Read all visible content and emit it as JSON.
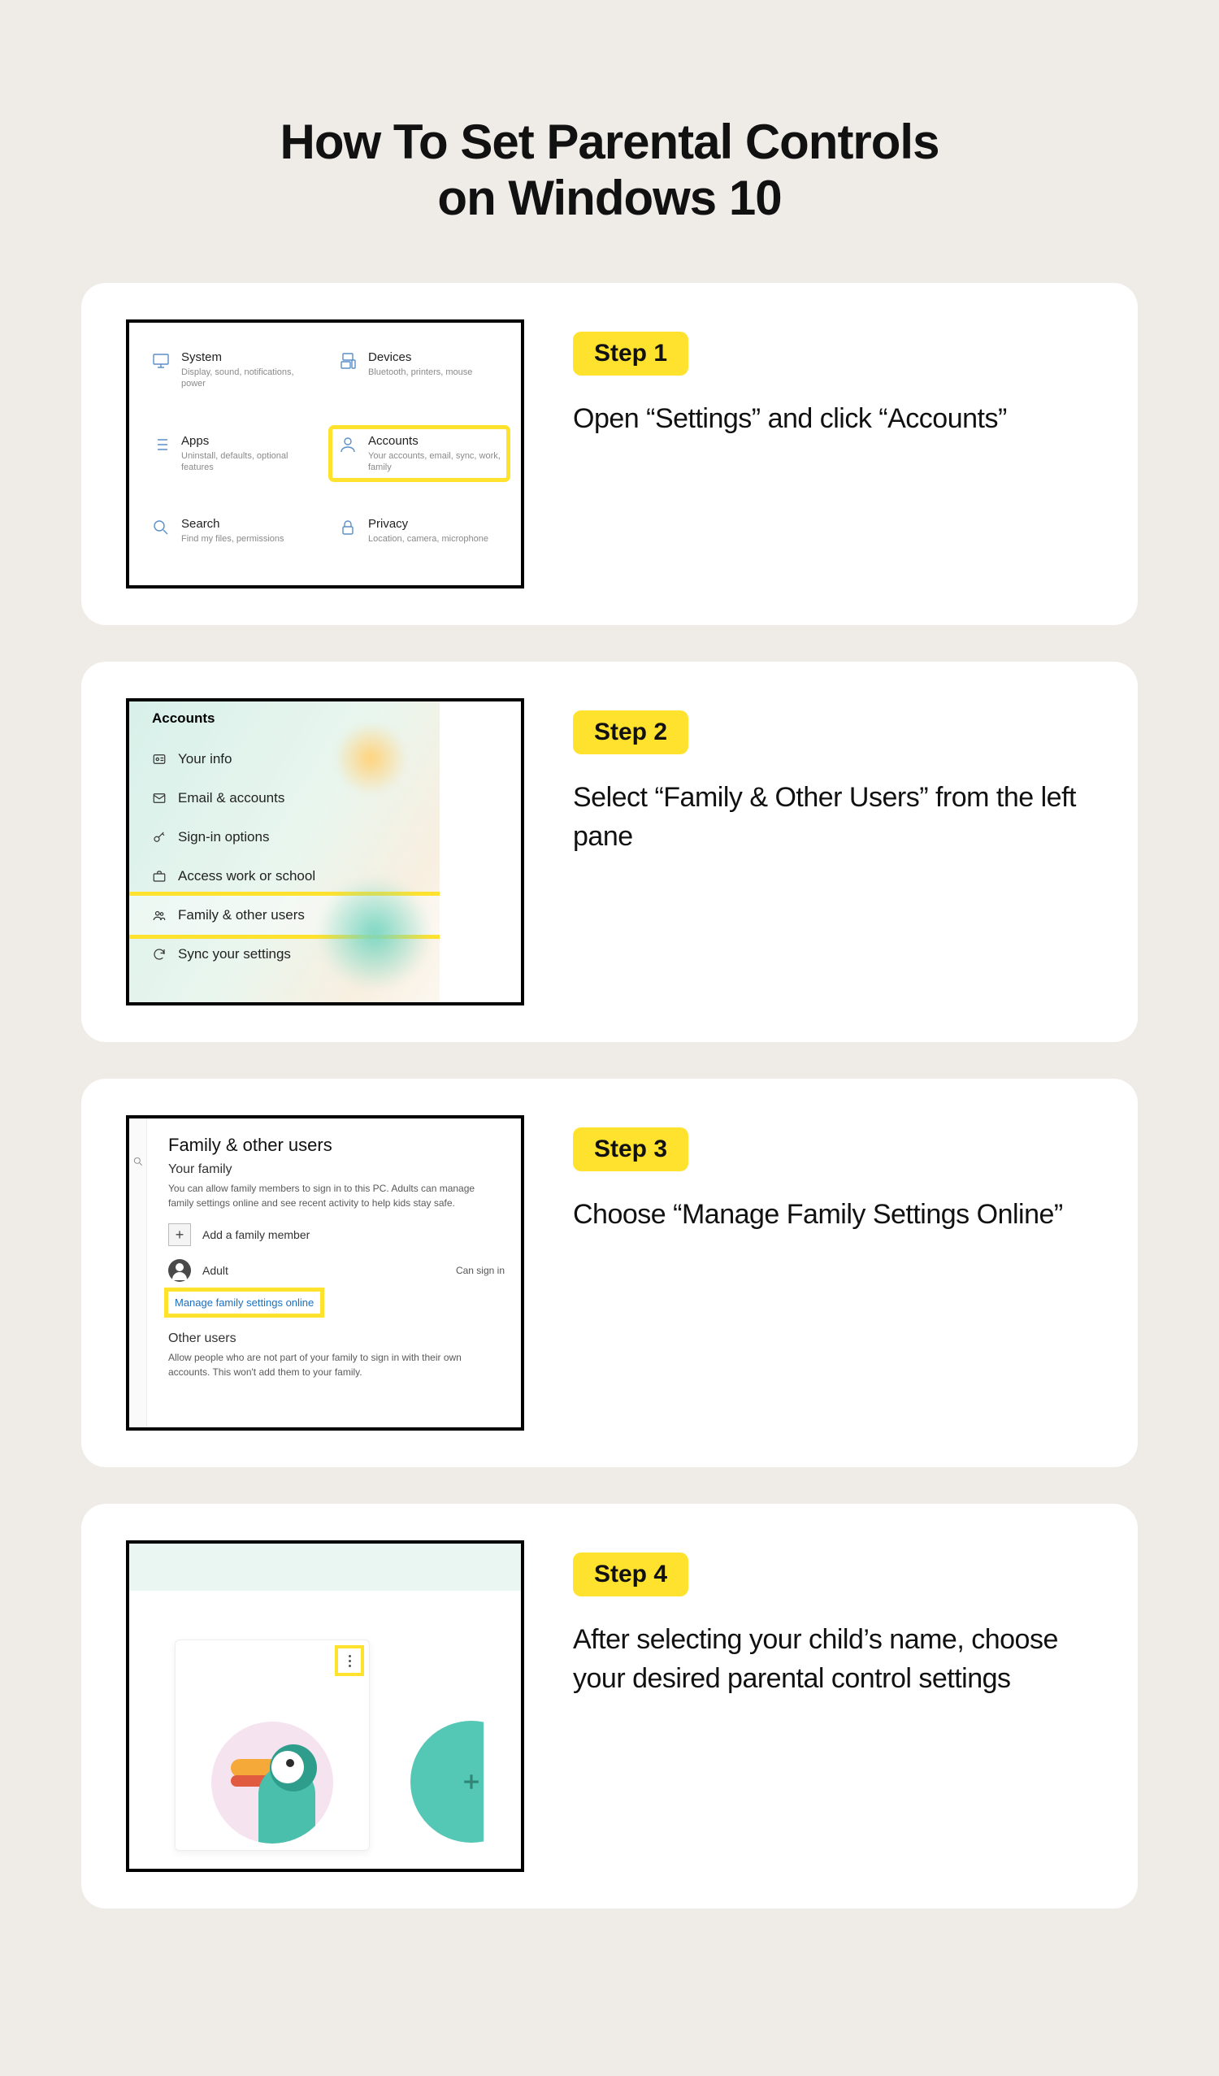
{
  "title_line1": "How To Set Parental Controls",
  "title_line2": "on Windows 10",
  "steps": [
    {
      "badge": "Step 1",
      "text": "Open “Settings” and click “Accounts”"
    },
    {
      "badge": "Step 2",
      "text": "Select “Family & Other Users” from the left pane"
    },
    {
      "badge": "Step 3",
      "text": "Choose “Manage Family Settings Online”"
    },
    {
      "badge": "Step 4",
      "text": "After selecting your child’s name, choose your desired parental control settings"
    }
  ],
  "shot1": {
    "tiles": [
      {
        "name": "System",
        "sub": "Display, sound, notifications, power",
        "icon": "monitor"
      },
      {
        "name": "Devices",
        "sub": "Bluetooth, printers, mouse",
        "icon": "devices"
      },
      {
        "name": "Apps",
        "sub": "Uninstall, defaults, optional features",
        "icon": "list"
      },
      {
        "name": "Accounts",
        "sub": "Your accounts, email, sync, work, family",
        "icon": "person",
        "highlight": true
      },
      {
        "name": "Search",
        "sub": "Find my files, permissions",
        "icon": "search"
      },
      {
        "name": "Privacy",
        "sub": "Location, camera, microphone",
        "icon": "lock"
      }
    ]
  },
  "shot2": {
    "header": "Accounts",
    "items": [
      {
        "label": "Your info",
        "icon": "idcard"
      },
      {
        "label": "Email & accounts",
        "icon": "mail"
      },
      {
        "label": "Sign-in options",
        "icon": "key"
      },
      {
        "label": "Access work or school",
        "icon": "briefcase"
      },
      {
        "label": "Family & other users",
        "icon": "people",
        "highlight": true
      },
      {
        "label": "Sync your settings",
        "icon": "sync"
      }
    ]
  },
  "shot3": {
    "heading": "Family & other users",
    "section1_title": "Your family",
    "section1_desc": "You can allow family members to sign in to this PC. Adults can manage family settings online and see recent activity to help kids stay safe.",
    "add_member": "Add a family member",
    "adult_label": "Adult",
    "can_sign_in": "Can sign in",
    "manage_link": "Manage family settings online",
    "section2_title": "Other users",
    "section2_desc": "Allow people who are not part of your family to sign in with their own accounts. This won't add them to your family."
  }
}
